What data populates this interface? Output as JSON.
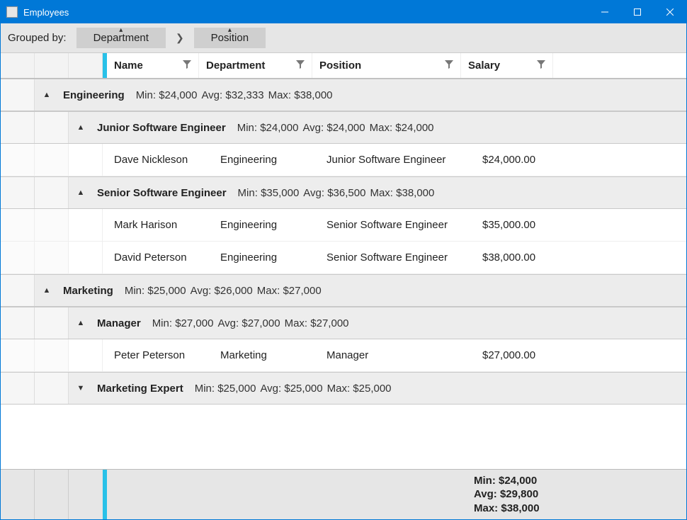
{
  "window": {
    "title": "Employees"
  },
  "groupbar": {
    "label": "Grouped by:",
    "chips": [
      "Department",
      "Position"
    ]
  },
  "columns": {
    "name": "Name",
    "dept": "Department",
    "pos": "Position",
    "sal": "Salary"
  },
  "groups": [
    {
      "title": "Engineering",
      "min": "$24,000",
      "avg": "$32,333",
      "max": "$38,000",
      "expanded": true,
      "subgroups": [
        {
          "title": "Junior Software Engineer",
          "min": "$24,000",
          "avg": "$24,000",
          "max": "$24,000",
          "expanded": true,
          "rows": [
            {
              "name": "Dave Nickleson",
              "dept": "Engineering",
              "pos": "Junior Software Engineer",
              "sal": "$24,000.00"
            }
          ]
        },
        {
          "title": "Senior Software Engineer",
          "min": "$35,000",
          "avg": "$36,500",
          "max": "$38,000",
          "expanded": true,
          "rows": [
            {
              "name": "Mark Harison",
              "dept": "Engineering",
              "pos": "Senior Software Engineer",
              "sal": "$35,000.00"
            },
            {
              "name": "David Peterson",
              "dept": "Engineering",
              "pos": "Senior Software Engineer",
              "sal": "$38,000.00"
            }
          ]
        }
      ]
    },
    {
      "title": "Marketing",
      "min": "$25,000",
      "avg": "$26,000",
      "max": "$27,000",
      "expanded": true,
      "subgroups": [
        {
          "title": "Manager",
          "min": "$27,000",
          "avg": "$27,000",
          "max": "$27,000",
          "expanded": true,
          "rows": [
            {
              "name": "Peter Peterson",
              "dept": "Marketing",
              "pos": "Manager",
              "sal": "$27,000.00"
            }
          ]
        },
        {
          "title": "Marketing Expert",
          "min": "$25,000",
          "avg": "$25,000",
          "max": "$25,000",
          "expanded": false,
          "rows": []
        }
      ]
    }
  ],
  "labels": {
    "min": "Min:",
    "avg": "Avg:",
    "max": "Max:"
  },
  "footer": {
    "min": "$24,000",
    "avg": "$29,800",
    "max": "$38,000"
  }
}
